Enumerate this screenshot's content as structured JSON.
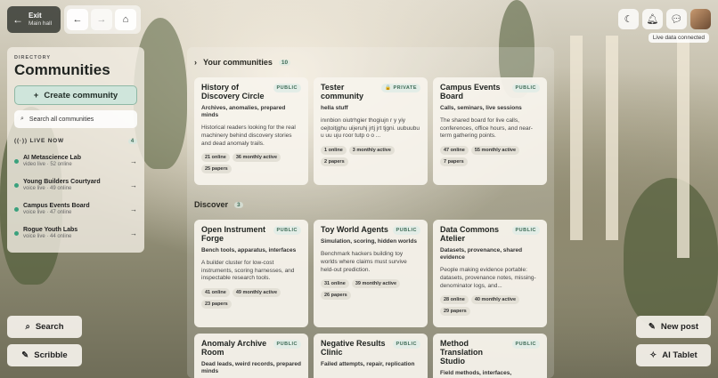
{
  "nav": {
    "exit_label": "Exit",
    "exit_sub": "Main hall",
    "back_icon": "←",
    "forward_icon": "→",
    "home_icon": "⌂"
  },
  "top_right": {
    "theme_icon": "☾",
    "bell_icon": "🔔︎",
    "chat_icon": "💬︎",
    "status": "Live data connected"
  },
  "directory": {
    "label": "DIRECTORY",
    "title": "Communities",
    "create_label": "Create community",
    "search_placeholder": "Search all communities",
    "live_label": "LIVE NOW",
    "live_count": "4",
    "live_items": [
      {
        "name": "AI Metascience Lab",
        "sub": "video live · 52 online"
      },
      {
        "name": "Young Builders Courtyard",
        "sub": "voice live · 49 online"
      },
      {
        "name": "Campus Events Board",
        "sub": "voice live · 47 online"
      },
      {
        "name": "Rogue Youth Labs",
        "sub": "voice live · 44 online"
      }
    ]
  },
  "bottom_left": {
    "search_label": "Search",
    "scribble_label": "Scribble"
  },
  "bottom_right": {
    "newpost_label": "New post",
    "tablet_label": "AI Tablet"
  },
  "main": {
    "your_label": "Your communities",
    "your_count": "10",
    "discover_label": "Discover",
    "discover_count": "3",
    "your_cards": [
      {
        "title": "History of Discovery Circle",
        "badge": "PUBLIC",
        "tags": "Archives, anomalies, prepared minds",
        "desc": "Historical readers looking for the real machinery behind discovery stories and dead anomaly trails.",
        "stats": [
          "21 online",
          "36 monthly active",
          "25 papers"
        ]
      },
      {
        "title": "Tester community",
        "badge": "🔒 PRIVATE",
        "tags": "hella stuff",
        "desc": "inınbion oiutrhgier thogiujn r y yiy oejtoitjghu uijeruhj jrtj jrt tjgni. uubuubu u uu uju roor tutp o o ...",
        "stats": [
          "1 online",
          "3 monthly active",
          "2 papers"
        ]
      },
      {
        "title": "Campus Events Board",
        "badge": "PUBLIC",
        "tags": "Calls, seminars, live sessions",
        "desc": "The shared board for live calls, conferences, office hours, and near-term gathering points.",
        "stats": [
          "47 online",
          "55 monthly active",
          "7 papers"
        ]
      }
    ],
    "discover_cards": [
      {
        "title": "Open Instrument Forge",
        "badge": "PUBLIC",
        "tags": "Bench tools, apparatus, interfaces",
        "desc": "A builder cluster for low-cost instruments, scoring harnesses, and inspectable research tools.",
        "stats": [
          "41 online",
          "49 monthly active",
          "23 papers"
        ]
      },
      {
        "title": "Toy World Agents",
        "badge": "PUBLIC",
        "tags": "Simulation, scoring, hidden worlds",
        "desc": "Benchmark hackers building toy worlds where claims must survive held-out prediction.",
        "stats": [
          "31 online",
          "39 monthly active",
          "26 papers"
        ]
      },
      {
        "title": "Data Commons Atelier",
        "badge": "PUBLIC",
        "tags": "Datasets, provenance, shared evidence",
        "desc": "People making evidence portable: datasets, provenance notes, missing-denominator logs, and...",
        "stats": [
          "28 online",
          "40 monthly active",
          "29 papers"
        ]
      },
      {
        "title": "Anomaly Archive Room",
        "badge": "PUBLIC",
        "tags": "Dead leads, weird records, prepared minds",
        "desc": "",
        "stats": []
      },
      {
        "title": "Negative Results Clinic",
        "badge": "PUBLIC",
        "tags": "Failed attempts, repair, replication",
        "desc": "",
        "stats": []
      },
      {
        "title": "Method Translation Studio",
        "badge": "PUBLIC",
        "tags": "Field methods, interfaces,",
        "desc": "",
        "stats": []
      }
    ]
  }
}
